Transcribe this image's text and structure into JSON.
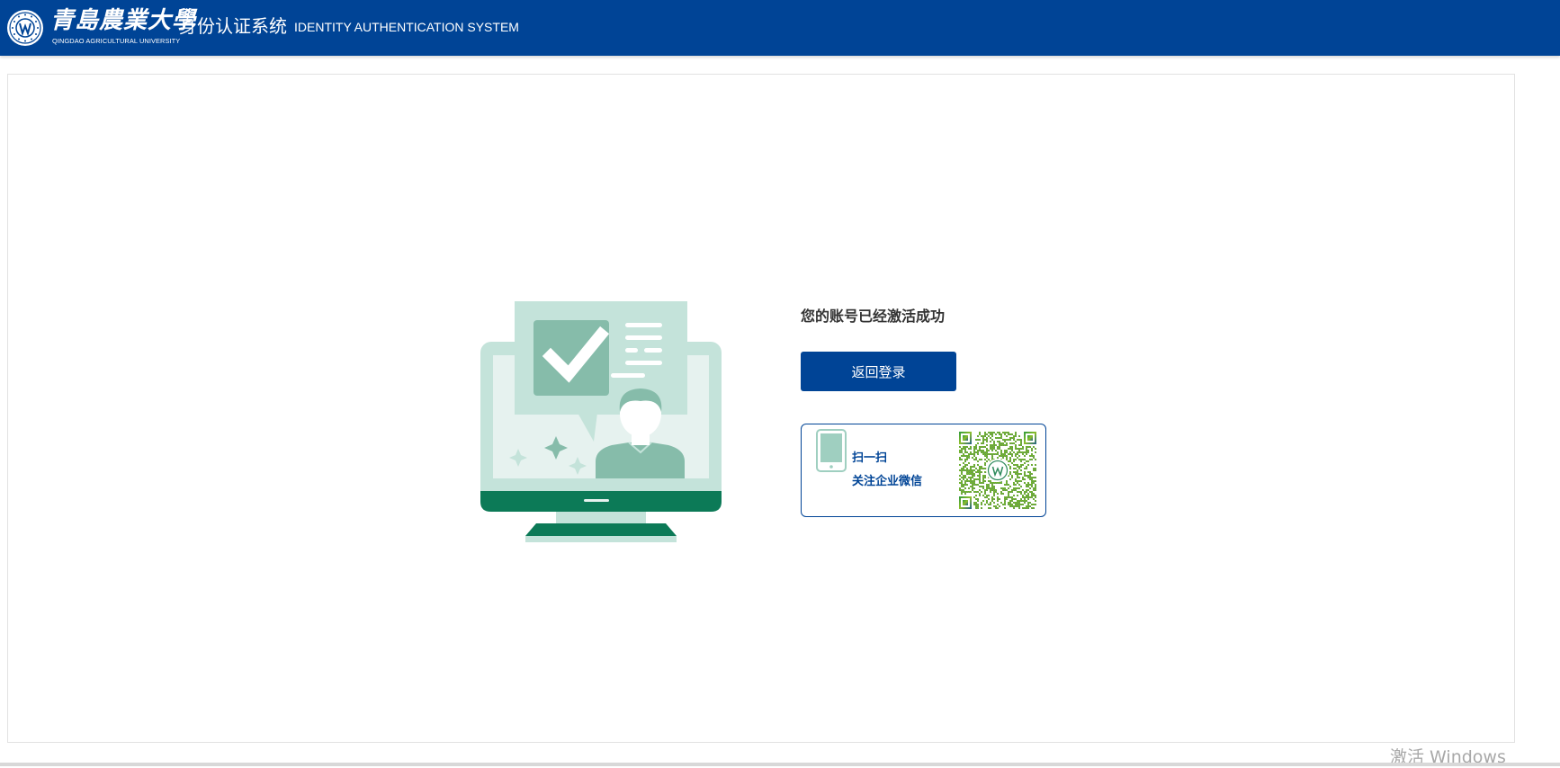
{
  "header": {
    "logo_cn": "青島農業大學",
    "logo_en": "QINGDAO AGRICULTURAL UNIVERSITY",
    "system_title_cn": "身份认证系统",
    "system_title_en": "IDENTITY AUTHENTICATION SYSTEM"
  },
  "main": {
    "success_message": "您的账号已经激活成功",
    "back_button_label": "返回登录",
    "wechat": {
      "line1": "扫一扫",
      "line2": "关注企业微信"
    }
  },
  "os_watermark": "激活 Windows",
  "colors": {
    "brand_blue": "#004496",
    "illustration_green": "#0c7a57",
    "illustration_mint": "#c4e3da"
  },
  "icons": {
    "seal": "university-seal-icon",
    "illustration": "account-activated-illustration",
    "phone": "mobile-phone-icon",
    "qr": "wechat-qr-code"
  }
}
